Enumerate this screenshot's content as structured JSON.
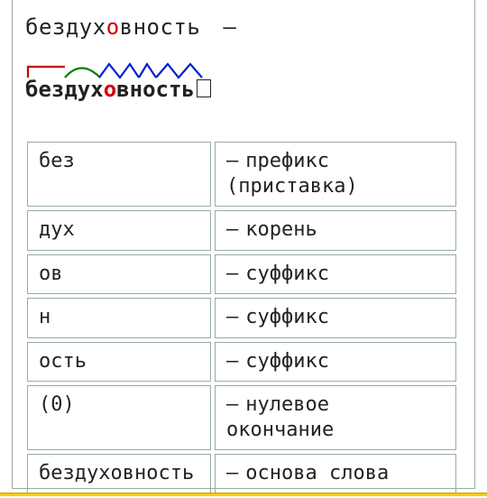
{
  "headline": {
    "pre": "бездух",
    "accent": "о",
    "post": "вность",
    "dash": "—"
  },
  "morph": {
    "t1": "без",
    "t2": "дух",
    "accent": "о",
    "t3": "вность"
  },
  "rows": [
    {
      "part": "без",
      "desc": "префикс (приставка)"
    },
    {
      "part": "дух",
      "desc": "корень"
    },
    {
      "part": "ов",
      "desc": "суффикс"
    },
    {
      "part": "н",
      "desc": "суффикс"
    },
    {
      "part": "ость",
      "desc": "суффикс"
    },
    {
      "part": "(0)",
      "desc": "нулевое окончание"
    },
    {
      "part": "бездуховность",
      "desc": "основа слова"
    }
  ],
  "dash": "—"
}
